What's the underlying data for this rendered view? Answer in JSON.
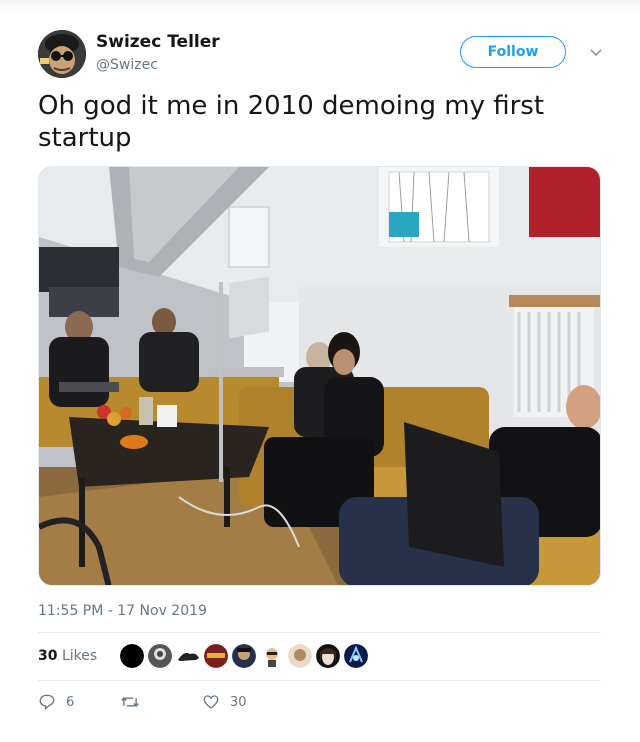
{
  "user": {
    "name": "Swizec Teller",
    "handle": "@Swizec",
    "follow_label": "Follow"
  },
  "tweet": {
    "text_line1": "Oh god it me in 2010 demoing my first",
    "text_line2": "startup",
    "timestamp": "11:55 PM - 17 Nov 2019"
  },
  "stats": {
    "likes_count": "30",
    "likes_label": "Likes"
  },
  "actions": {
    "reply_count": "6",
    "retweet_count": "",
    "like_count": "30"
  },
  "colors": {
    "accent": "#1da1f2",
    "text": "#14171a",
    "muted": "#657786",
    "divider": "#e6ecf0"
  },
  "icons": [
    "chevron-down-icon",
    "reply-icon",
    "retweet-icon",
    "heart-icon"
  ]
}
